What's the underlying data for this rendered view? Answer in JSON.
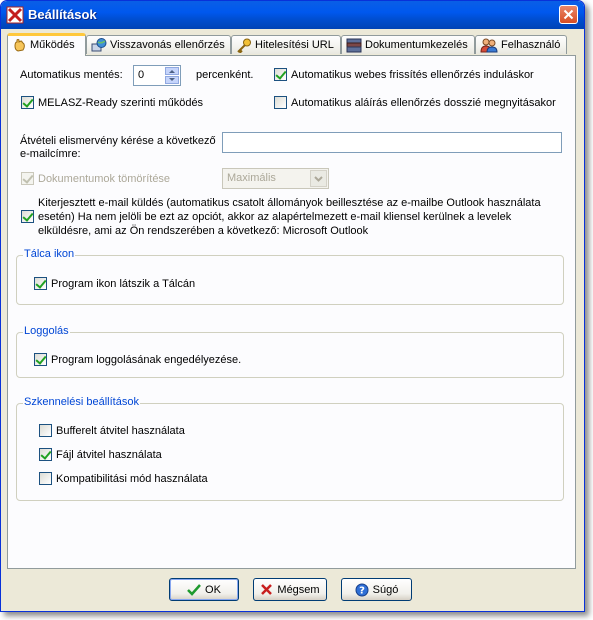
{
  "window": {
    "title": "Beállítások"
  },
  "tabs": [
    {
      "label": "Működés",
      "icon": "hand-icon"
    },
    {
      "label": "Visszavonás ellenőrzés",
      "icon": "globe-pc-icon"
    },
    {
      "label": "Hitelesítési URL",
      "icon": "key-icon"
    },
    {
      "label": "Dokumentumkezelés",
      "icon": "document-stack-icon"
    },
    {
      "label": "Felhasználó",
      "icon": "users-icon"
    }
  ],
  "settings": {
    "auto_save_label": "Automatikus mentés:",
    "auto_save_value": "0",
    "auto_save_unit": "percenként.",
    "auto_update_label": "Automatikus webes frissítés ellenőrzés induláskor",
    "auto_update_checked": true,
    "melasz_label": "MELASZ-Ready szerinti működés",
    "melasz_checked": true,
    "auto_sign_label": "Automatikus aláírás ellenőrzés dosszié megnyitásakor",
    "auto_sign_checked": false,
    "receipt_label_line1": "Átvételi elismervény kérése a következő",
    "receipt_label_line2": "e-mailcímre:",
    "receipt_email_value": "",
    "compress_label": "Dokumentumok tömörítése",
    "compress_checked": true,
    "compress_select_value": "Maximális",
    "email_send_line1": "Kiterjesztett e-mail küldés (automatikus csatolt állományok beillesztése az e-mailbe Outlook használata",
    "email_send_line2": "esetén) Ha nem jelöli be ezt az opciót, akkor az alapértelmezett e-mail kliensel kerülnek a levelek",
    "email_send_line3": "elküldésre, ami az Ön rendszerében a következő: Microsoft Outlook",
    "email_send_checked": true
  },
  "tray_group": {
    "title": "Tálca ikon",
    "show_icon_label": "Program ikon látszik a Tálcán",
    "show_icon_checked": true
  },
  "logging_group": {
    "title": "Loggolás",
    "enable_label": "Program loggolásának engedélyezése.",
    "enable_checked": true
  },
  "scan_group": {
    "title": "Szkennelési beállítások",
    "buffered_label": "Bufferelt átvitel használata",
    "buffered_checked": false,
    "file_label": "Fájl átvitel használata",
    "file_checked": true,
    "compat_label": "Kompatibilitási mód használata",
    "compat_checked": false
  },
  "buttons": {
    "ok": "OK",
    "cancel": "Mégsem",
    "help": "Súgó"
  },
  "colors": {
    "title_bar": "#0058ee",
    "group_title": "#0046d5",
    "dialog_bg": "#ece9d8",
    "panel_bg": "#fcfcfe",
    "check_mark": "#21a121"
  }
}
